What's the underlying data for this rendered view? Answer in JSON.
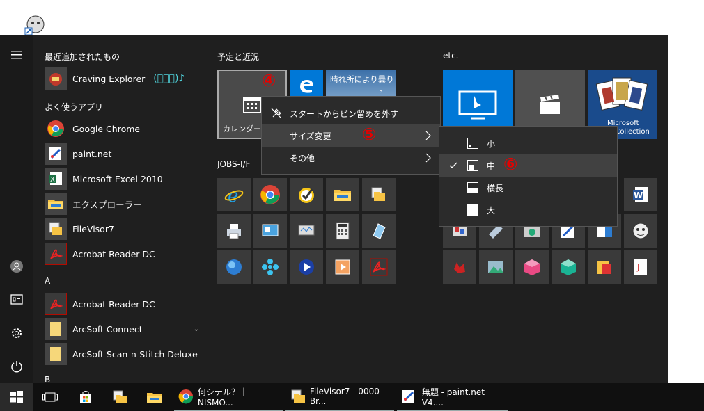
{
  "recent_header": "最近追加されたもの",
  "recent_apps": [
    {
      "label": "Craving Explorer",
      "note": "(ﾟ〜ﾟ)♪"
    }
  ],
  "frequent_header": "よく使うアプリ",
  "frequent_apps": [
    {
      "label": "Google Chrome"
    },
    {
      "label": "paint.net"
    },
    {
      "label": "Microsoft Excel 2010"
    },
    {
      "label": "エクスプローラー"
    },
    {
      "label": "FileVisor7"
    },
    {
      "label": "Acrobat Reader DC"
    }
  ],
  "alpha_a": "A",
  "a_apps": [
    {
      "label": "Acrobat Reader DC",
      "chev": ""
    },
    {
      "label": "ArcSoft Connect",
      "chev": "⌄"
    },
    {
      "label": "ArcSoft Scan-n-Stitch Deluxe",
      "chev": "⌄"
    }
  ],
  "alpha_b": "B",
  "groups": {
    "g1": "予定と近況",
    "g2": "JOBS-I/F",
    "g3": "etc."
  },
  "tiles": {
    "calendar_label": "カレンダー",
    "weather_label": "晴れ所により曇り",
    "weather_temp": "°",
    "solitaire_label1": "Microsoft",
    "solitaire_label2": "e Collection",
    "word_text": "W"
  },
  "annotations": {
    "n4": "④",
    "n5": "⑤",
    "n6": "⑥"
  },
  "context_menu": {
    "unpin": "スタートからピン留めを外す",
    "resize": "サイズ変更",
    "more": "その他"
  },
  "submenu": {
    "items": [
      {
        "label": "小",
        "checked": false
      },
      {
        "label": "中",
        "checked": true
      },
      {
        "label": "横長",
        "checked": false
      },
      {
        "label": "大",
        "checked": false
      }
    ]
  },
  "taskbar": {
    "tasks": [
      {
        "label": "何シテル？｜NISMO..."
      },
      {
        "label": "FileVisor7 - 0000-Br..."
      },
      {
        "label": "無題 - paint.net V4...."
      }
    ]
  },
  "colors": {
    "accent": "#0078d7",
    "annotation": "#e60000",
    "bg": "#1f1f1f"
  }
}
